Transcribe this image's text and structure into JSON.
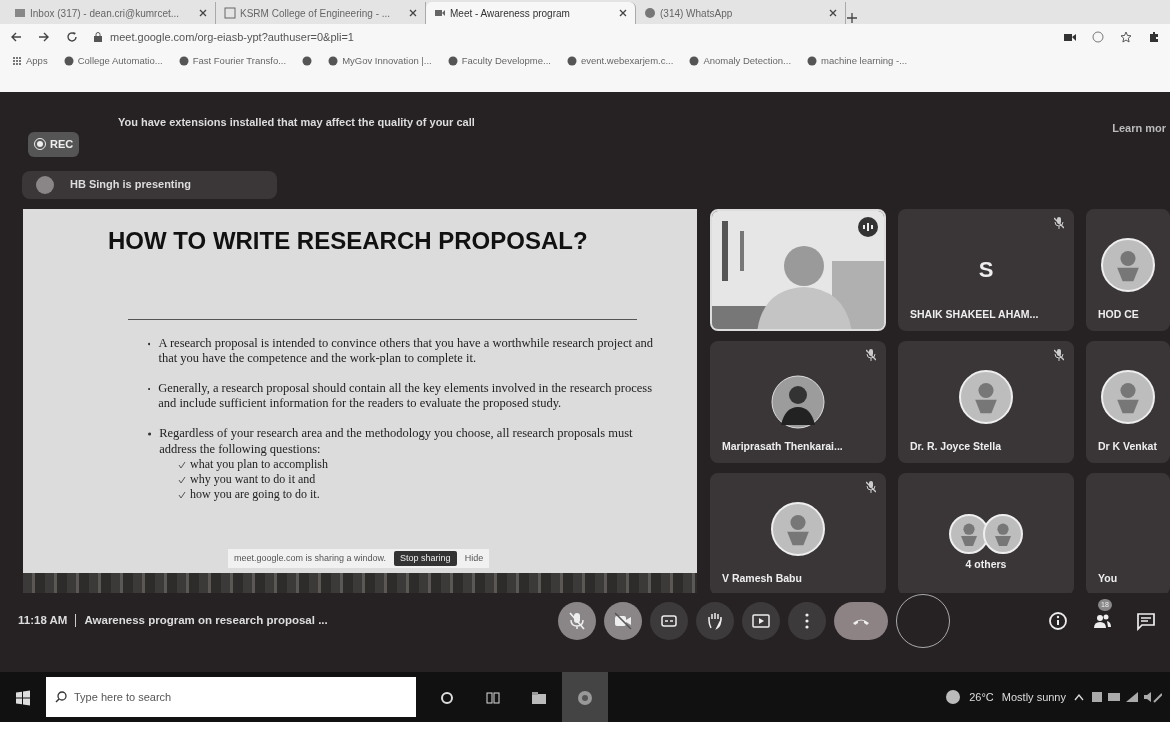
{
  "browser": {
    "tabs": [
      {
        "title": "Inbox (317) - dean.cri@kumrcet...",
        "kind": "mail",
        "selected": false
      },
      {
        "title": "KSRM College of Engineering - ...",
        "kind": "site",
        "selected": false
      },
      {
        "title": "Meet - Awareness program",
        "kind": "meet",
        "selected": true
      },
      {
        "title": "(314) WhatsApp",
        "kind": "chat",
        "selected": false
      }
    ],
    "address": "meet.google.com/org-eiasb-ypt?authuser=0&pli=1",
    "bookmarks": [
      {
        "kind": "apps",
        "label": "Apps"
      },
      {
        "kind": "site",
        "label": "College Automatio..."
      },
      {
        "kind": "site",
        "label": "Fast Fourier Transfo..."
      },
      {
        "kind": "site"
      },
      {
        "kind": "site",
        "label": "MyGov Innovation |..."
      },
      {
        "kind": "site",
        "label": "Faculty Developme..."
      },
      {
        "kind": "site",
        "label": "event.webexarjem.c..."
      },
      {
        "kind": "site",
        "label": "Anomaly Detection..."
      },
      {
        "kind": "site",
        "label": "machine learning -..."
      }
    ]
  },
  "meet": {
    "banner": {
      "text": "You have extensions installed that may affect the quality of your call",
      "link": "Learn mor"
    },
    "recording": {
      "label": "REC"
    },
    "presenting": "HB Singh is presenting",
    "slide": {
      "title": "HOW TO WRITE RESEARCH PROPOSAL?",
      "bullets": [
        {
          "text": "A research proposal is intended to convince others that you have a worthwhile research project and that you have the competence and the work-plan to complete it."
        },
        {
          "text": "Generally, a research proposal should contain all the key elements involved in the research process and include sufficient information for the readers to evaluate the proposed study."
        },
        {
          "text": "Regardless of your research area and the methodology you choose, all research proposals must address the following questions:",
          "children": [
            {
              "text": "what you plan to accomplish"
            },
            {
              "text": "why you want to do it and"
            },
            {
              "text": "how you are going to do it."
            }
          ]
        }
      ]
    },
    "share_bar": {
      "text": "meet.google.com is sharing a window.",
      "stop": "Stop sharing",
      "hide": "Hide"
    },
    "tiles": [
      {
        "kind": "video",
        "muted": false,
        "speaking": true
      },
      {
        "kind": "letter",
        "letter": "S",
        "name": "SHAIK SHAKEEL AHAM...",
        "muted": true,
        "speaking": false
      },
      {
        "kind": "emblem",
        "name": "HOD CE",
        "muted": false,
        "speaking": false
      },
      {
        "name": "Mariprasath Thenkarai...",
        "muted": true,
        "speaking": false
      },
      {
        "kind": "emblem",
        "name": "Dr. R. Joyce Stella",
        "muted": true,
        "speaking": false
      },
      {
        "kind": "emblem",
        "name": "Dr K Venkat",
        "muted": false,
        "speaking": false
      },
      {
        "kind": "emblem",
        "name": "V Ramesh Babu",
        "muted": true,
        "speaking": false
      },
      {
        "kind": "group",
        "name": "4 others",
        "muted": false,
        "speaking": false
      },
      {
        "kind": "self",
        "name": "You",
        "muted": false,
        "speaking": false
      }
    ],
    "time": "11:18 AM",
    "meeting_title": "Awareness program on research proposal ...",
    "controls": [
      {
        "kind": "mic",
        "on": false
      },
      {
        "kind": "camera",
        "on": false
      },
      {
        "kind": "captions"
      },
      {
        "kind": "hand"
      },
      {
        "kind": "present"
      },
      {
        "kind": "more"
      },
      {
        "kind": "end"
      },
      {
        "kind": "ring"
      }
    ],
    "side_controls": [
      {
        "kind": "info"
      },
      {
        "kind": "people",
        "badge": "18"
      },
      {
        "kind": "chat"
      }
    ]
  },
  "taskbar": {
    "search_placeholder": "Type here to search",
    "apps": [
      {
        "kind": "cortana",
        "selected": false
      },
      {
        "kind": "taskview",
        "selected": false
      },
      {
        "kind": "files",
        "selected": false
      },
      {
        "kind": "browser",
        "selected": true
      }
    ],
    "temperature": "26°C",
    "weather": "Mostly sunny"
  }
}
